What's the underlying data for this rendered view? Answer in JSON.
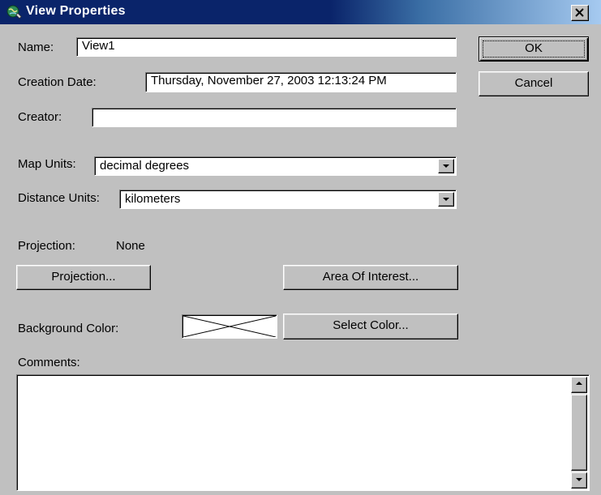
{
  "window": {
    "title": "View Properties",
    "icon": "globe-view-icon",
    "close_icon": "close-icon"
  },
  "form": {
    "name_label": "Name:",
    "name_value": "View1",
    "creation_date_label": "Creation Date:",
    "creation_date_value": "Thursday, November 27, 2003 12:13:24 PM",
    "creator_label": "Creator:",
    "creator_value": "",
    "map_units_label": "Map Units:",
    "map_units_value": "decimal degrees",
    "distance_units_label": "Distance Units:",
    "distance_units_value": "kilometers",
    "projection_label": "Projection:",
    "projection_value": "None",
    "background_color_label": "Background Color:",
    "comments_label": "Comments:",
    "comments_value": ""
  },
  "buttons": {
    "ok": "OK",
    "cancel": "Cancel",
    "projection": "Projection...",
    "area_of_interest": "Area Of Interest...",
    "select_color": "Select Color..."
  },
  "colors": {
    "titlebar_start": "#0a246a",
    "titlebar_end": "#a6caf0",
    "face": "#c0c0c0"
  }
}
